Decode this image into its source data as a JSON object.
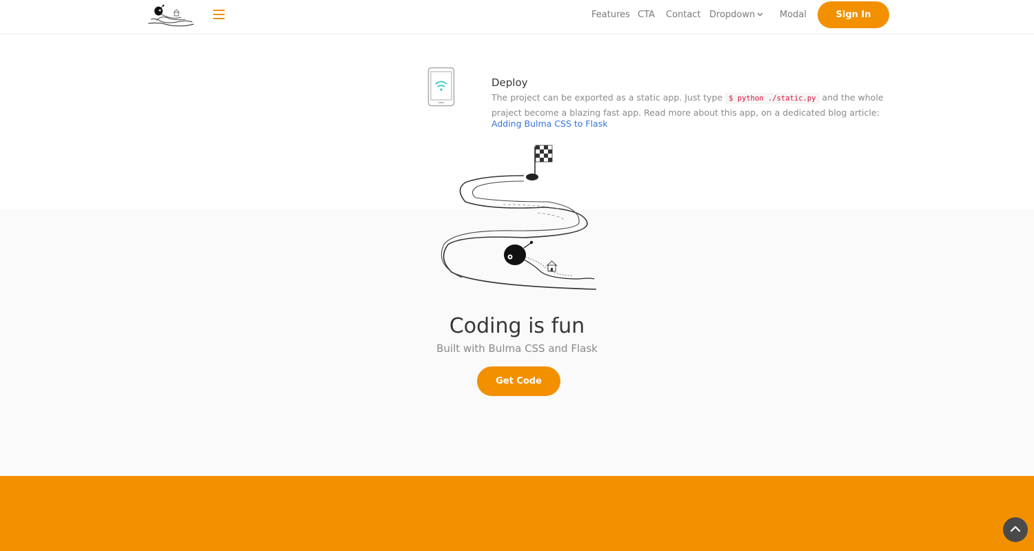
{
  "navbar": {
    "logo_icon": "snail-logo-icon",
    "menu_icon": "hamburger-menu-icon",
    "items": [
      {
        "label": "Features"
      },
      {
        "label": "CTA"
      },
      {
        "label": "Contact"
      },
      {
        "label": "Dropdown"
      },
      {
        "label": "Modal"
      }
    ],
    "dropdown_icon": "chevron-down-icon",
    "signin_label": "Sign In"
  },
  "feature": {
    "icon": "tablet-wifi-icon",
    "title": "Deploy",
    "text_before": "The project can be exported as a static app. Just type ",
    "code": "$ python ./static.py",
    "text_after": " and the whole praject become a blazing fast app. Read more about this app, on a dedicated blog article:",
    "link_label": "Adding Bulma CSS to Flask"
  },
  "hero": {
    "illustration": "snail-road-illustration",
    "title": "Coding is fun",
    "subtitle": "Built with Bulma CSS and Flask",
    "button_label": "Get Code"
  },
  "back_to_top_icon": "chevron-up-icon",
  "colors": {
    "accent": "#f29000",
    "link": "#3273dc",
    "code": "#da1039",
    "hero_bg": "#fafafa",
    "back_to_top_bg": "#4a4a4a"
  }
}
